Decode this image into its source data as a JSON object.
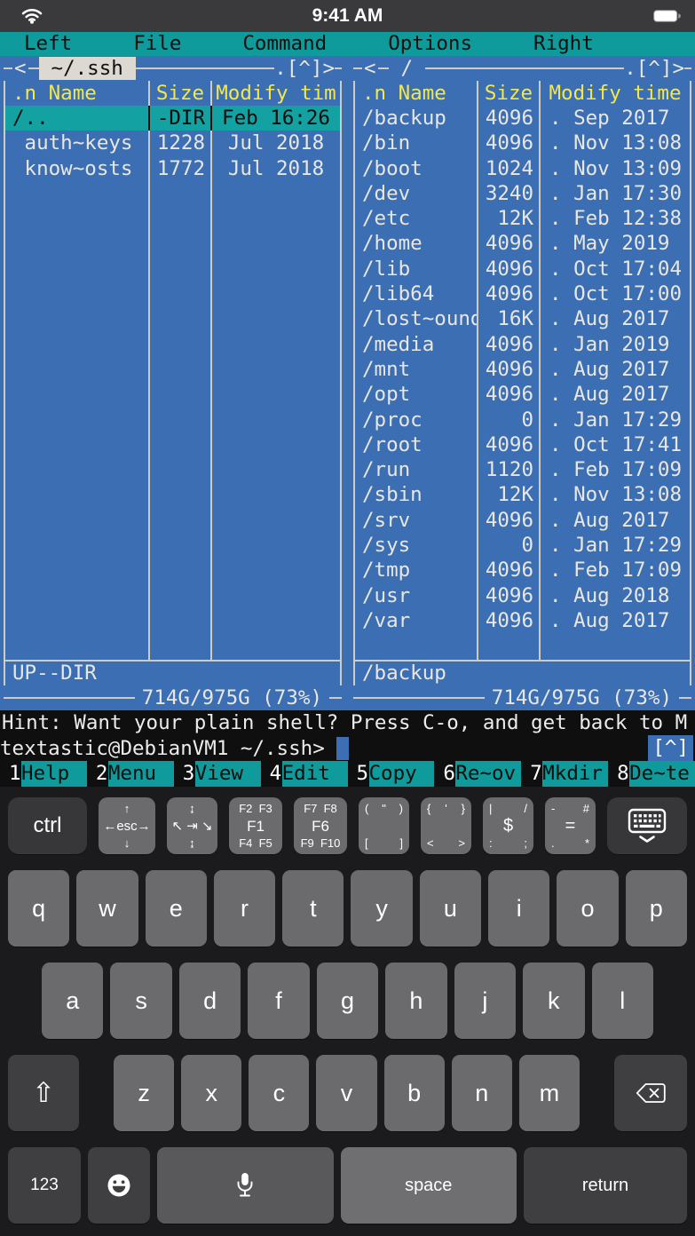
{
  "colors": {
    "panel_blue": "#3c6eb4",
    "menu_teal": "#0f9b9b",
    "selection_teal": "#14a1a1",
    "header_yellow": "#f3e84b",
    "panel_text": "#e9e7e1",
    "border_line": "#cfccc4",
    "terminal_black": "#0f0f0f",
    "status_bar_gray": "#3a3a3c",
    "cursor_blue": "#3c6eb4",
    "keyboard_bg": "#1b1b1d",
    "key_gray": "#6b6b6e",
    "key_dark_gray": "#3f3f42"
  },
  "status_bar": {
    "time": "9:41 AM",
    "wifi_icon": "wifi-icon",
    "battery_icon": "battery-full-icon"
  },
  "menu_bar": {
    "items": [
      "Left",
      "File",
      "Command",
      "Options",
      "Right"
    ]
  },
  "panels": {
    "left": {
      "history_arrow": "<",
      "title": "~/.ssh",
      "title_active": true,
      "top_indicator": ".[^]>",
      "columns": [
        ".n Name",
        "Size",
        "Modify tim"
      ],
      "rows": [
        {
          "name": "/..",
          "size": "-DIR",
          "date": "Feb 16:26",
          "selected": true
        },
        {
          "name": " auth~keys",
          "size": "1228",
          "date": "Jul 2018",
          "selected": false
        },
        {
          "name": " know~osts",
          "size": "1772",
          "date": "Jul 2018",
          "selected": false
        }
      ],
      "mini_status": "UP--DIR",
      "free_space": "714G/975G (73%)"
    },
    "right": {
      "history_arrow": "<",
      "title": "/",
      "title_active": false,
      "top_indicator": ".[^]>",
      "columns": [
        ".n Name",
        "Size",
        "Modify time"
      ],
      "rows": [
        {
          "name": "/backup",
          "size": "4096",
          "date": ". Sep 2017",
          "selected": false
        },
        {
          "name": "/bin",
          "size": "4096",
          "date": ". Nov 13:08",
          "selected": false
        },
        {
          "name": "/boot",
          "size": "1024",
          "date": ". Nov 13:09",
          "selected": false
        },
        {
          "name": "/dev",
          "size": "3240",
          "date": ". Jan 17:30",
          "selected": false
        },
        {
          "name": "/etc",
          "size": "12K",
          "date": ". Feb 12:38",
          "selected": false
        },
        {
          "name": "/home",
          "size": "4096",
          "date": ". May 2019",
          "selected": false
        },
        {
          "name": "/lib",
          "size": "4096",
          "date": ". Oct 17:04",
          "selected": false
        },
        {
          "name": "/lib64",
          "size": "4096",
          "date": ". Oct 17:00",
          "selected": false
        },
        {
          "name": "/lost~ound",
          "size": "16K",
          "date": ". Aug 2017",
          "selected": false
        },
        {
          "name": "/media",
          "size": "4096",
          "date": ". Jan 2019",
          "selected": false
        },
        {
          "name": "/mnt",
          "size": "4096",
          "date": ". Aug 2017",
          "selected": false
        },
        {
          "name": "/opt",
          "size": "4096",
          "date": ". Aug 2017",
          "selected": false
        },
        {
          "name": "/proc",
          "size": "0",
          "date": ". Jan 17:29",
          "selected": false
        },
        {
          "name": "/root",
          "size": "4096",
          "date": ". Oct 17:41",
          "selected": false
        },
        {
          "name": "/run",
          "size": "1120",
          "date": ". Feb 17:09",
          "selected": false
        },
        {
          "name": "/sbin",
          "size": "12K",
          "date": ". Nov 13:08",
          "selected": false
        },
        {
          "name": "/srv",
          "size": "4096",
          "date": ". Aug 2017",
          "selected": false
        },
        {
          "name": "/sys",
          "size": "0",
          "date": ". Jan 17:29",
          "selected": false
        },
        {
          "name": "/tmp",
          "size": "4096",
          "date": ". Feb 17:09",
          "selected": false
        },
        {
          "name": "/usr",
          "size": "4096",
          "date": ". Aug 2018",
          "selected": false
        },
        {
          "name": "/var",
          "size": "4096",
          "date": ". Aug 2017",
          "selected": false
        }
      ],
      "mini_status": "/backup",
      "free_space": "714G/975G (73%)"
    }
  },
  "terminal": {
    "hint": "Hint: Want your plain shell? Press C-o, and get back to M",
    "prompt": "textastic@DebianVM1 ~/.ssh>",
    "cursor": "block",
    "scroll_indicator": "[^]"
  },
  "function_keys": [
    {
      "num": "1",
      "label": "Help"
    },
    {
      "num": "2",
      "label": "Menu"
    },
    {
      "num": "3",
      "label": "View"
    },
    {
      "num": "4",
      "label": "Edit"
    },
    {
      "num": "5",
      "label": "Copy"
    },
    {
      "num": "6",
      "label": "Re~ov"
    },
    {
      "num": "7",
      "label": "Mkdir"
    },
    {
      "num": "8",
      "label": "De~te"
    }
  ],
  "accessory_row": {
    "keys": [
      {
        "kind": "ctrl",
        "name": "ctrl-key",
        "label": "ctrl"
      },
      {
        "kind": "tri",
        "cls": "k-esc",
        "name": "esc-arrows-key",
        "top": "↑",
        "mid": "←esc→",
        "bottom": "↓"
      },
      {
        "kind": "tri",
        "cls": "k-nav",
        "name": "nav-home-tab-end-key",
        "top": "↨",
        "mid": "↖ ⇥ ↘",
        "bottom": "↨"
      },
      {
        "kind": "tri",
        "cls": "k-f1",
        "name": "fkeys-1-5-key",
        "top": "F2  F3",
        "mid": "F1",
        "bottom": "F4  F5",
        "big_mid": true
      },
      {
        "kind": "tri",
        "cls": "k-f6",
        "name": "fkeys-6-10-key",
        "top": "F7  F8",
        "mid": "F6",
        "bottom": "F9  F10",
        "big_mid": true
      },
      {
        "kind": "sym",
        "name": "paren-doublequote-bracket-key",
        "top": [
          "(",
          "\"",
          ")"
        ],
        "mid": "",
        "bottom": [
          "[",
          "]"
        ]
      },
      {
        "kind": "sym",
        "name": "brace-quote-angle-key",
        "top": [
          "{",
          "'",
          "}"
        ],
        "mid": "",
        "bottom": [
          "<",
          ">"
        ]
      },
      {
        "kind": "sym",
        "name": "pipe-slash-dollar-key",
        "top": [
          "|",
          "",
          "/"
        ],
        "mid": "$",
        "bottom": [
          ":",
          ";"
        ]
      },
      {
        "kind": "sym",
        "name": "dash-hash-equals-key",
        "top": [
          "-",
          "",
          "#"
        ],
        "mid": "=",
        "bottom": [
          ".",
          "*"
        ]
      },
      {
        "kind": "dismiss",
        "name": "dismiss-keyboard-key",
        "icon": "keyboard-dismiss-icon"
      }
    ]
  },
  "keyboard": {
    "row1": [
      "q",
      "w",
      "e",
      "r",
      "t",
      "y",
      "u",
      "i",
      "o",
      "p"
    ],
    "row2": [
      "a",
      "s",
      "d",
      "f",
      "g",
      "h",
      "j",
      "k",
      "l"
    ],
    "row3": [
      "z",
      "x",
      "c",
      "v",
      "b",
      "n",
      "m"
    ],
    "shift_icon": "⇧",
    "backspace_icon": "backspace-icon",
    "bottom": {
      "num_label": "123",
      "emoji_icon": "emoji-smiley-icon",
      "mic_icon": "microphone-icon",
      "space_label": "space",
      "return_label": "return"
    }
  }
}
